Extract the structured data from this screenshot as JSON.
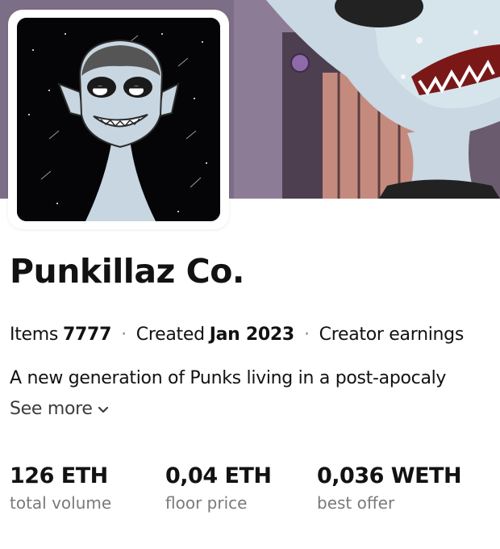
{
  "collection": {
    "name": "Punkillaz Co.",
    "items_label": "Items",
    "items_value": "7777",
    "created_label": "Created",
    "created_value": "Jan 2023",
    "creator_earnings_label": "Creator earnings",
    "description": "A new generation of Punks living in a post-apocaly",
    "see_more_label": "See more"
  },
  "stats": [
    {
      "value": "126 ETH",
      "label": "total volume"
    },
    {
      "value": "0,04 ETH",
      "label": "floor price"
    },
    {
      "value": "0,036 WETH",
      "label": "best offer"
    }
  ],
  "icons": {
    "see_more": "chevron-down-icon",
    "separator": "·"
  },
  "colors": {
    "text": "#121212",
    "muted": "#7a7a7a",
    "banner": "#7a6b84",
    "avatar_bg": "#050507"
  }
}
